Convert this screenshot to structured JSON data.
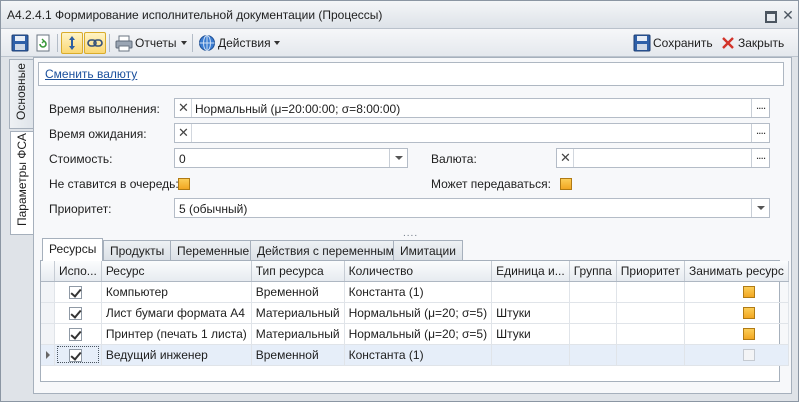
{
  "window": {
    "title": "А4.2.4.1 Формирование исполнительной документации (Процессы)",
    "restore_icon": "restore-icon",
    "close_label": "✕"
  },
  "toolbar": {
    "reports_label": "Отчеты",
    "actions_label": "Действия",
    "save_label": "Сохранить",
    "close_label": "Закрыть"
  },
  "side_tabs": {
    "main": "Основные",
    "fsa_params": "Параметры ФСА"
  },
  "currency_link": "Сменить валюту",
  "form": {
    "exec_time_label": "Время выполнения:",
    "exec_time_value": "Нормальный (μ=20:00:00; σ=8:00:00)",
    "wait_time_label": "Время ожидания:",
    "wait_time_value": "",
    "cost_label": "Стоимость:",
    "cost_value": "0",
    "currency_label": "Валюта:",
    "currency_value": "",
    "no_queue_label": "Не ставится в очередь:",
    "transferable_label": "Может передаваться:",
    "priority_label": "Приоритет:",
    "priority_value": "5 (обычный)",
    "ellipsis": "...."
  },
  "tabs": [
    "Ресурсы",
    "Продукты",
    "Переменные",
    "Действия с переменными",
    "Имитации"
  ],
  "grid": {
    "columns": [
      "Испо...",
      "Ресурс",
      "Тип ресурса",
      "Количество",
      "Единица и...",
      "Группа",
      "Приоритет",
      "Занимать ресурс"
    ],
    "rows": [
      {
        "used": true,
        "resource": "Компьютер",
        "type": "Временной",
        "qty": "Константа (1)",
        "unit": "",
        "group": "",
        "priority": "",
        "occupy": true,
        "current": false
      },
      {
        "used": true,
        "resource": "Лист бумаги формата А4",
        "type": "Материальный",
        "qty": "Нормальный (μ=20; σ=5)",
        "unit": "Штуки",
        "group": "",
        "priority": "",
        "occupy": true,
        "current": false
      },
      {
        "used": true,
        "resource": "Принтер (печать 1 листа)",
        "type": "Материальный",
        "qty": "Нормальный (μ=20; σ=5)",
        "unit": "Штуки",
        "group": "",
        "priority": "",
        "occupy": true,
        "current": false
      },
      {
        "used": true,
        "resource": "Ведущий инженер",
        "type": "Временной",
        "qty": "Константа (1)",
        "unit": "",
        "group": "",
        "priority": "",
        "occupy": false,
        "current": true
      }
    ]
  }
}
